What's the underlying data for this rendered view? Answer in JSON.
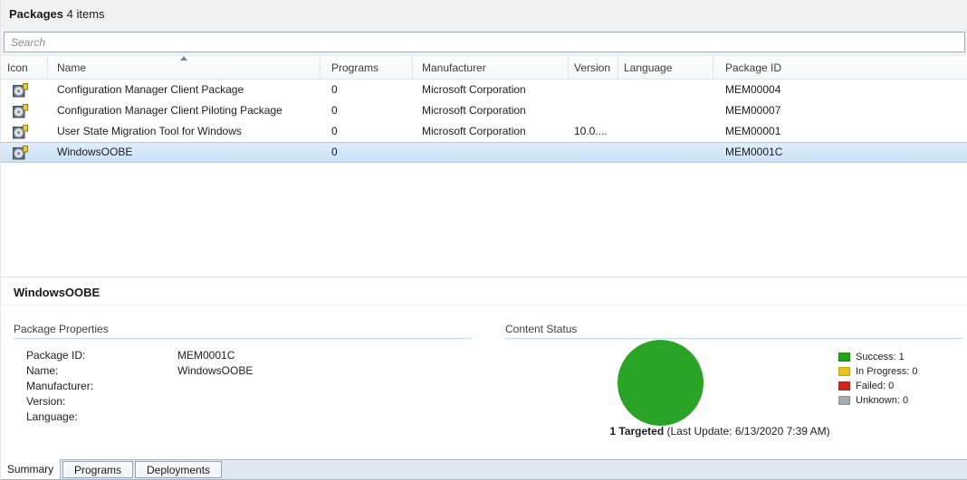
{
  "header": {
    "title": "Packages",
    "count_text": "4 items"
  },
  "search": {
    "placeholder": "Search"
  },
  "table": {
    "columns": [
      {
        "label": "Icon"
      },
      {
        "label": "Name",
        "sorted": "ascending"
      },
      {
        "label": "Programs"
      },
      {
        "label": "Manufacturer"
      },
      {
        "label": "Version"
      },
      {
        "label": "Language"
      },
      {
        "label": "Package ID"
      }
    ],
    "rows": [
      {
        "icon": "package-icon",
        "name": "Configuration Manager Client Package",
        "programs": "0",
        "manufacturer": "Microsoft Corporation",
        "version": "",
        "language": "",
        "package_id": "MEM00004",
        "selected": false
      },
      {
        "icon": "package-icon",
        "name": "Configuration Manager Client Piloting Package",
        "programs": "0",
        "manufacturer": "Microsoft Corporation",
        "version": "",
        "language": "",
        "package_id": "MEM00007",
        "selected": false
      },
      {
        "icon": "package-icon",
        "name": "User State Migration Tool for Windows",
        "programs": "0",
        "manufacturer": "Microsoft Corporation",
        "version": "10.0....",
        "language": "",
        "package_id": "MEM00001",
        "selected": false
      },
      {
        "icon": "package-icon",
        "name": "WindowsOOBE",
        "programs": "0",
        "manufacturer": "",
        "version": "",
        "language": "",
        "package_id": "MEM0001C",
        "selected": true
      }
    ]
  },
  "details": {
    "title": "WindowsOOBE",
    "package_properties": {
      "heading": "Package Properties",
      "fields": [
        {
          "label": "Package ID:",
          "value": "MEM0001C"
        },
        {
          "label": "Name:",
          "value": "WindowsOOBE"
        },
        {
          "label": "Manufacturer:",
          "value": ""
        },
        {
          "label": "Version:",
          "value": ""
        },
        {
          "label": "Language:",
          "value": ""
        }
      ]
    },
    "content_status": {
      "heading": "Content Status",
      "chart": {
        "type": "pie",
        "slices": [
          {
            "label": "Success",
            "value": 1,
            "color": "#2ba327"
          },
          {
            "label": "In Progress",
            "value": 0,
            "color": "#e3c51c"
          },
          {
            "label": "Failed",
            "value": 0,
            "color": "#c62b22"
          },
          {
            "label": "Unknown",
            "value": 0,
            "color": "#a8abae"
          }
        ]
      },
      "pie_color": "#2ba327",
      "legend": [
        {
          "label": "Success: 1",
          "color": "#24a21f"
        },
        {
          "label": "In Progress: 0",
          "color": "#e3c51c"
        },
        {
          "label": "Failed: 0",
          "color": "#c62b22"
        },
        {
          "label": "Unknown: 0",
          "color": "#a8abae"
        }
      ],
      "targeted_bold": "1 Targeted",
      "targeted_rest": " (Last Update: 6/13/2020 7:39 AM)"
    }
  },
  "tabs": [
    {
      "label": "Summary",
      "active": true
    },
    {
      "label": "Programs",
      "active": false
    },
    {
      "label": "Deployments",
      "active": false
    }
  ]
}
